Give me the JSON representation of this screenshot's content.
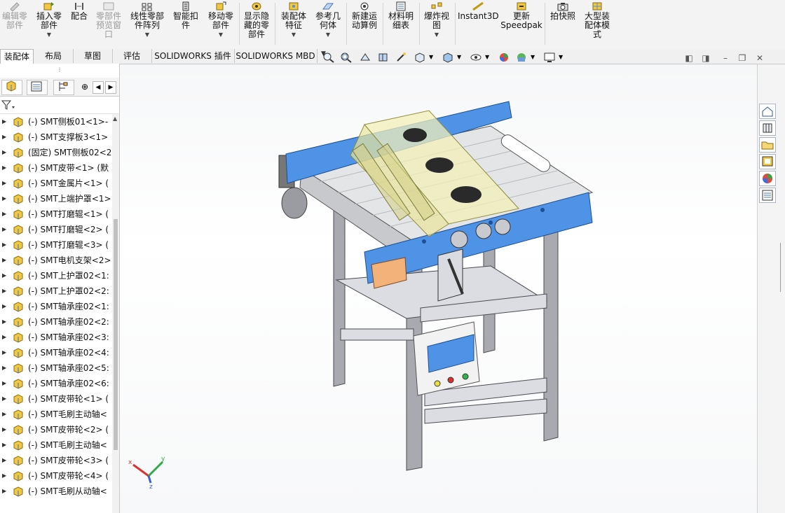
{
  "ribbon": {
    "items": [
      {
        "label": "编辑零\n部件",
        "icon": "edit-component-icon",
        "disabled": true
      },
      {
        "label": "插入零\n部件",
        "icon": "insert-components-icon",
        "dropdown": true
      },
      {
        "label": "配合",
        "icon": "mate-icon"
      },
      {
        "label": "零部件\n预览窗\n口",
        "icon": "component-preview-icon",
        "disabled": true
      },
      {
        "label": "线性零部\n件阵列",
        "icon": "linear-pattern-icon",
        "dropdown": true
      },
      {
        "label": "智能扣\n件",
        "icon": "smart-fasteners-icon"
      },
      {
        "label": "移动零\n部件",
        "icon": "move-component-icon",
        "dropdown": true
      },
      {
        "label": "显示隐\n藏的零\n部件",
        "icon": "show-hidden-icon"
      },
      {
        "label": "装配体\n特征",
        "icon": "assembly-features-icon",
        "dropdown": true
      },
      {
        "label": "参考几\n何体",
        "icon": "reference-geometry-icon",
        "dropdown": true
      },
      {
        "label": "新建运\n动算例",
        "icon": "motion-study-icon"
      },
      {
        "label": "材料明\n细表",
        "icon": "bom-icon"
      },
      {
        "label": "爆炸视\n图",
        "icon": "exploded-view-icon",
        "dropdown": true
      },
      {
        "label": "Instant3D",
        "icon": "instant3d-icon"
      },
      {
        "label": "更新\nSpeedpak",
        "icon": "speedpak-icon"
      },
      {
        "label": "拍快照",
        "icon": "snapshot-icon"
      },
      {
        "label": "大型装\n配体模\n式",
        "icon": "large-assembly-icon"
      }
    ]
  },
  "tabs": [
    "装配体",
    "布局",
    "草图",
    "评估",
    "SOLIDWORKS 插件",
    "SOLIDWORKS MBD"
  ],
  "tree": {
    "items": [
      "(-) SMT侧板01<1>-",
      "(-) SMT支撑板3<1>",
      "(固定) SMT侧板02<2",
      "(-) SMT皮带<1> (默",
      "(-) SMT金属片<1> (",
      "(-) SMT上端护罩<1>",
      "(-) SMT打磨辊<1> (",
      "(-) SMT打磨辊<2> (",
      "(-) SMT打磨辊<3> (",
      "(-) SMT电机支架<2>",
      "(-) SMT上护罩02<1:",
      "(-) SMT上护罩02<2:",
      "(-) SMT轴承座02<1:",
      "(-) SMT轴承座02<2:",
      "(-) SMT轴承座02<3:",
      "(-) SMT轴承座02<4:",
      "(-) SMT轴承座02<5:",
      "(-) SMT轴承座02<6:",
      "(-) SMT皮带轮<1> (",
      "(-) SMT毛刷主动轴<",
      "(-) SMT皮带轮<2> (",
      "(-) SMT毛刷主动轴<",
      "(-) SMT皮带轮<3> (",
      "(-) SMT皮带轮<4> (",
      "(-) SMT毛刷从动轴<"
    ]
  },
  "triad": {
    "x": "x",
    "y": "y",
    "z": "z"
  },
  "colors": {
    "accent": "#4f93e6",
    "frame": "#a9aab0",
    "panel": "#dfe1e3"
  }
}
